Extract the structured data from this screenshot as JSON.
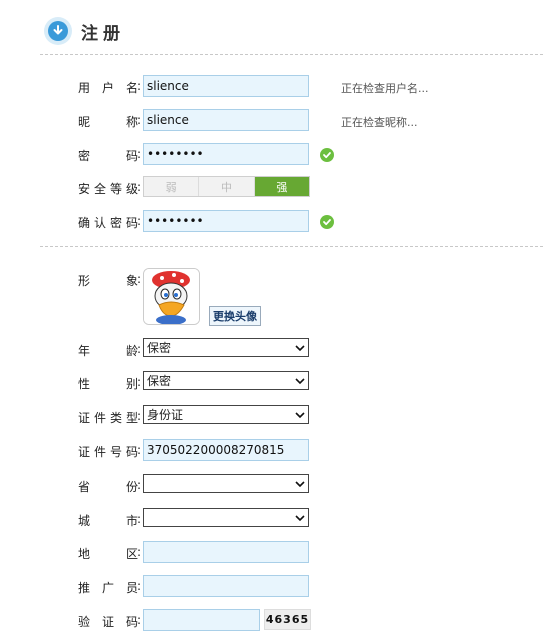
{
  "header": {
    "title": "注册",
    "icon": "download-circle-icon"
  },
  "account": {
    "username": {
      "label": "用户名",
      "value": "slience",
      "hint": "正在检查用户名..."
    },
    "nickname": {
      "label": "昵称",
      "value": "slience",
      "hint": "正在检查昵称..."
    },
    "password": {
      "label": "密码",
      "value": "abcdefgh"
    },
    "strength": {
      "label": "安全等级",
      "levels": [
        "弱",
        "中",
        "强"
      ],
      "active": "强"
    },
    "confirm": {
      "label": "确认密码",
      "value": "abcdefgh"
    }
  },
  "profile": {
    "avatar_label": "形象",
    "change_avatar": "更换头像",
    "age": {
      "label": "年龄",
      "value": "保密"
    },
    "gender": {
      "label": "性别",
      "value": "保密"
    },
    "id_type": {
      "label": "证件类型",
      "value": "身份证"
    },
    "id_number": {
      "label": "证件号码",
      "value": "370502200008270815"
    },
    "province": {
      "label": "省份",
      "value": ""
    },
    "city": {
      "label": "城市",
      "value": ""
    },
    "district": {
      "label": "地区",
      "value": ""
    },
    "referrer": {
      "label": "推广员",
      "value": ""
    },
    "captcha": {
      "label": "验证码",
      "value": "",
      "image_text": "46365"
    }
  },
  "colors": {
    "accent": "#3a9ad9",
    "input_bg": "#e8f5fd",
    "strong": "#67a833",
    "ok": "#6cbf3f"
  }
}
